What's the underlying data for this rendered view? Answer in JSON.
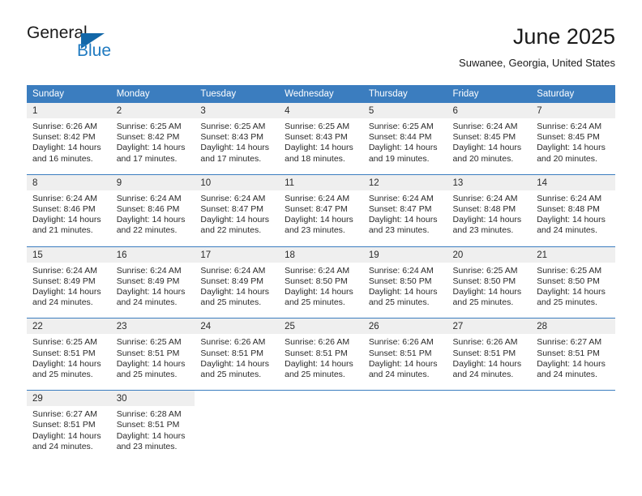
{
  "branding": {
    "logo_text_primary": "General",
    "logo_text_secondary": "Blue",
    "logo_icon": "triangle-icon",
    "accent_color": "#1267a8",
    "secondary_color": "#1f7ac0"
  },
  "header": {
    "title": "June 2025",
    "location": "Suwanee, Georgia, United States"
  },
  "calendar": {
    "header_bg": "#3b7dbf",
    "daynum_bg": "#efefef",
    "weekday_headers": [
      "Sunday",
      "Monday",
      "Tuesday",
      "Wednesday",
      "Thursday",
      "Friday",
      "Saturday"
    ],
    "labels": {
      "sunrise": "Sunrise:",
      "sunset": "Sunset:",
      "daylight": "Daylight:"
    },
    "weeks": [
      [
        {
          "day": "1",
          "sunrise": "Sunrise: 6:26 AM",
          "sunset": "Sunset: 8:42 PM",
          "daylight": "Daylight: 14 hours and 16 minutes."
        },
        {
          "day": "2",
          "sunrise": "Sunrise: 6:25 AM",
          "sunset": "Sunset: 8:42 PM",
          "daylight": "Daylight: 14 hours and 17 minutes."
        },
        {
          "day": "3",
          "sunrise": "Sunrise: 6:25 AM",
          "sunset": "Sunset: 8:43 PM",
          "daylight": "Daylight: 14 hours and 17 minutes."
        },
        {
          "day": "4",
          "sunrise": "Sunrise: 6:25 AM",
          "sunset": "Sunset: 8:43 PM",
          "daylight": "Daylight: 14 hours and 18 minutes."
        },
        {
          "day": "5",
          "sunrise": "Sunrise: 6:25 AM",
          "sunset": "Sunset: 8:44 PM",
          "daylight": "Daylight: 14 hours and 19 minutes."
        },
        {
          "day": "6",
          "sunrise": "Sunrise: 6:24 AM",
          "sunset": "Sunset: 8:45 PM",
          "daylight": "Daylight: 14 hours and 20 minutes."
        },
        {
          "day": "7",
          "sunrise": "Sunrise: 6:24 AM",
          "sunset": "Sunset: 8:45 PM",
          "daylight": "Daylight: 14 hours and 20 minutes."
        }
      ],
      [
        {
          "day": "8",
          "sunrise": "Sunrise: 6:24 AM",
          "sunset": "Sunset: 8:46 PM",
          "daylight": "Daylight: 14 hours and 21 minutes."
        },
        {
          "day": "9",
          "sunrise": "Sunrise: 6:24 AM",
          "sunset": "Sunset: 8:46 PM",
          "daylight": "Daylight: 14 hours and 22 minutes."
        },
        {
          "day": "10",
          "sunrise": "Sunrise: 6:24 AM",
          "sunset": "Sunset: 8:47 PM",
          "daylight": "Daylight: 14 hours and 22 minutes."
        },
        {
          "day": "11",
          "sunrise": "Sunrise: 6:24 AM",
          "sunset": "Sunset: 8:47 PM",
          "daylight": "Daylight: 14 hours and 23 minutes."
        },
        {
          "day": "12",
          "sunrise": "Sunrise: 6:24 AM",
          "sunset": "Sunset: 8:47 PM",
          "daylight": "Daylight: 14 hours and 23 minutes."
        },
        {
          "day": "13",
          "sunrise": "Sunrise: 6:24 AM",
          "sunset": "Sunset: 8:48 PM",
          "daylight": "Daylight: 14 hours and 23 minutes."
        },
        {
          "day": "14",
          "sunrise": "Sunrise: 6:24 AM",
          "sunset": "Sunset: 8:48 PM",
          "daylight": "Daylight: 14 hours and 24 minutes."
        }
      ],
      [
        {
          "day": "15",
          "sunrise": "Sunrise: 6:24 AM",
          "sunset": "Sunset: 8:49 PM",
          "daylight": "Daylight: 14 hours and 24 minutes."
        },
        {
          "day": "16",
          "sunrise": "Sunrise: 6:24 AM",
          "sunset": "Sunset: 8:49 PM",
          "daylight": "Daylight: 14 hours and 24 minutes."
        },
        {
          "day": "17",
          "sunrise": "Sunrise: 6:24 AM",
          "sunset": "Sunset: 8:49 PM",
          "daylight": "Daylight: 14 hours and 25 minutes."
        },
        {
          "day": "18",
          "sunrise": "Sunrise: 6:24 AM",
          "sunset": "Sunset: 8:50 PM",
          "daylight": "Daylight: 14 hours and 25 minutes."
        },
        {
          "day": "19",
          "sunrise": "Sunrise: 6:24 AM",
          "sunset": "Sunset: 8:50 PM",
          "daylight": "Daylight: 14 hours and 25 minutes."
        },
        {
          "day": "20",
          "sunrise": "Sunrise: 6:25 AM",
          "sunset": "Sunset: 8:50 PM",
          "daylight": "Daylight: 14 hours and 25 minutes."
        },
        {
          "day": "21",
          "sunrise": "Sunrise: 6:25 AM",
          "sunset": "Sunset: 8:50 PM",
          "daylight": "Daylight: 14 hours and 25 minutes."
        }
      ],
      [
        {
          "day": "22",
          "sunrise": "Sunrise: 6:25 AM",
          "sunset": "Sunset: 8:51 PM",
          "daylight": "Daylight: 14 hours and 25 minutes."
        },
        {
          "day": "23",
          "sunrise": "Sunrise: 6:25 AM",
          "sunset": "Sunset: 8:51 PM",
          "daylight": "Daylight: 14 hours and 25 minutes."
        },
        {
          "day": "24",
          "sunrise": "Sunrise: 6:26 AM",
          "sunset": "Sunset: 8:51 PM",
          "daylight": "Daylight: 14 hours and 25 minutes."
        },
        {
          "day": "25",
          "sunrise": "Sunrise: 6:26 AM",
          "sunset": "Sunset: 8:51 PM",
          "daylight": "Daylight: 14 hours and 25 minutes."
        },
        {
          "day": "26",
          "sunrise": "Sunrise: 6:26 AM",
          "sunset": "Sunset: 8:51 PM",
          "daylight": "Daylight: 14 hours and 24 minutes."
        },
        {
          "day": "27",
          "sunrise": "Sunrise: 6:26 AM",
          "sunset": "Sunset: 8:51 PM",
          "daylight": "Daylight: 14 hours and 24 minutes."
        },
        {
          "day": "28",
          "sunrise": "Sunrise: 6:27 AM",
          "sunset": "Sunset: 8:51 PM",
          "daylight": "Daylight: 14 hours and 24 minutes."
        }
      ],
      [
        {
          "day": "29",
          "sunrise": "Sunrise: 6:27 AM",
          "sunset": "Sunset: 8:51 PM",
          "daylight": "Daylight: 14 hours and 24 minutes."
        },
        {
          "day": "30",
          "sunrise": "Sunrise: 6:28 AM",
          "sunset": "Sunset: 8:51 PM",
          "daylight": "Daylight: 14 hours and 23 minutes."
        },
        {
          "day": "",
          "sunrise": "",
          "sunset": "",
          "daylight": ""
        },
        {
          "day": "",
          "sunrise": "",
          "sunset": "",
          "daylight": ""
        },
        {
          "day": "",
          "sunrise": "",
          "sunset": "",
          "daylight": ""
        },
        {
          "day": "",
          "sunrise": "",
          "sunset": "",
          "daylight": ""
        },
        {
          "day": "",
          "sunrise": "",
          "sunset": "",
          "daylight": ""
        }
      ]
    ]
  }
}
